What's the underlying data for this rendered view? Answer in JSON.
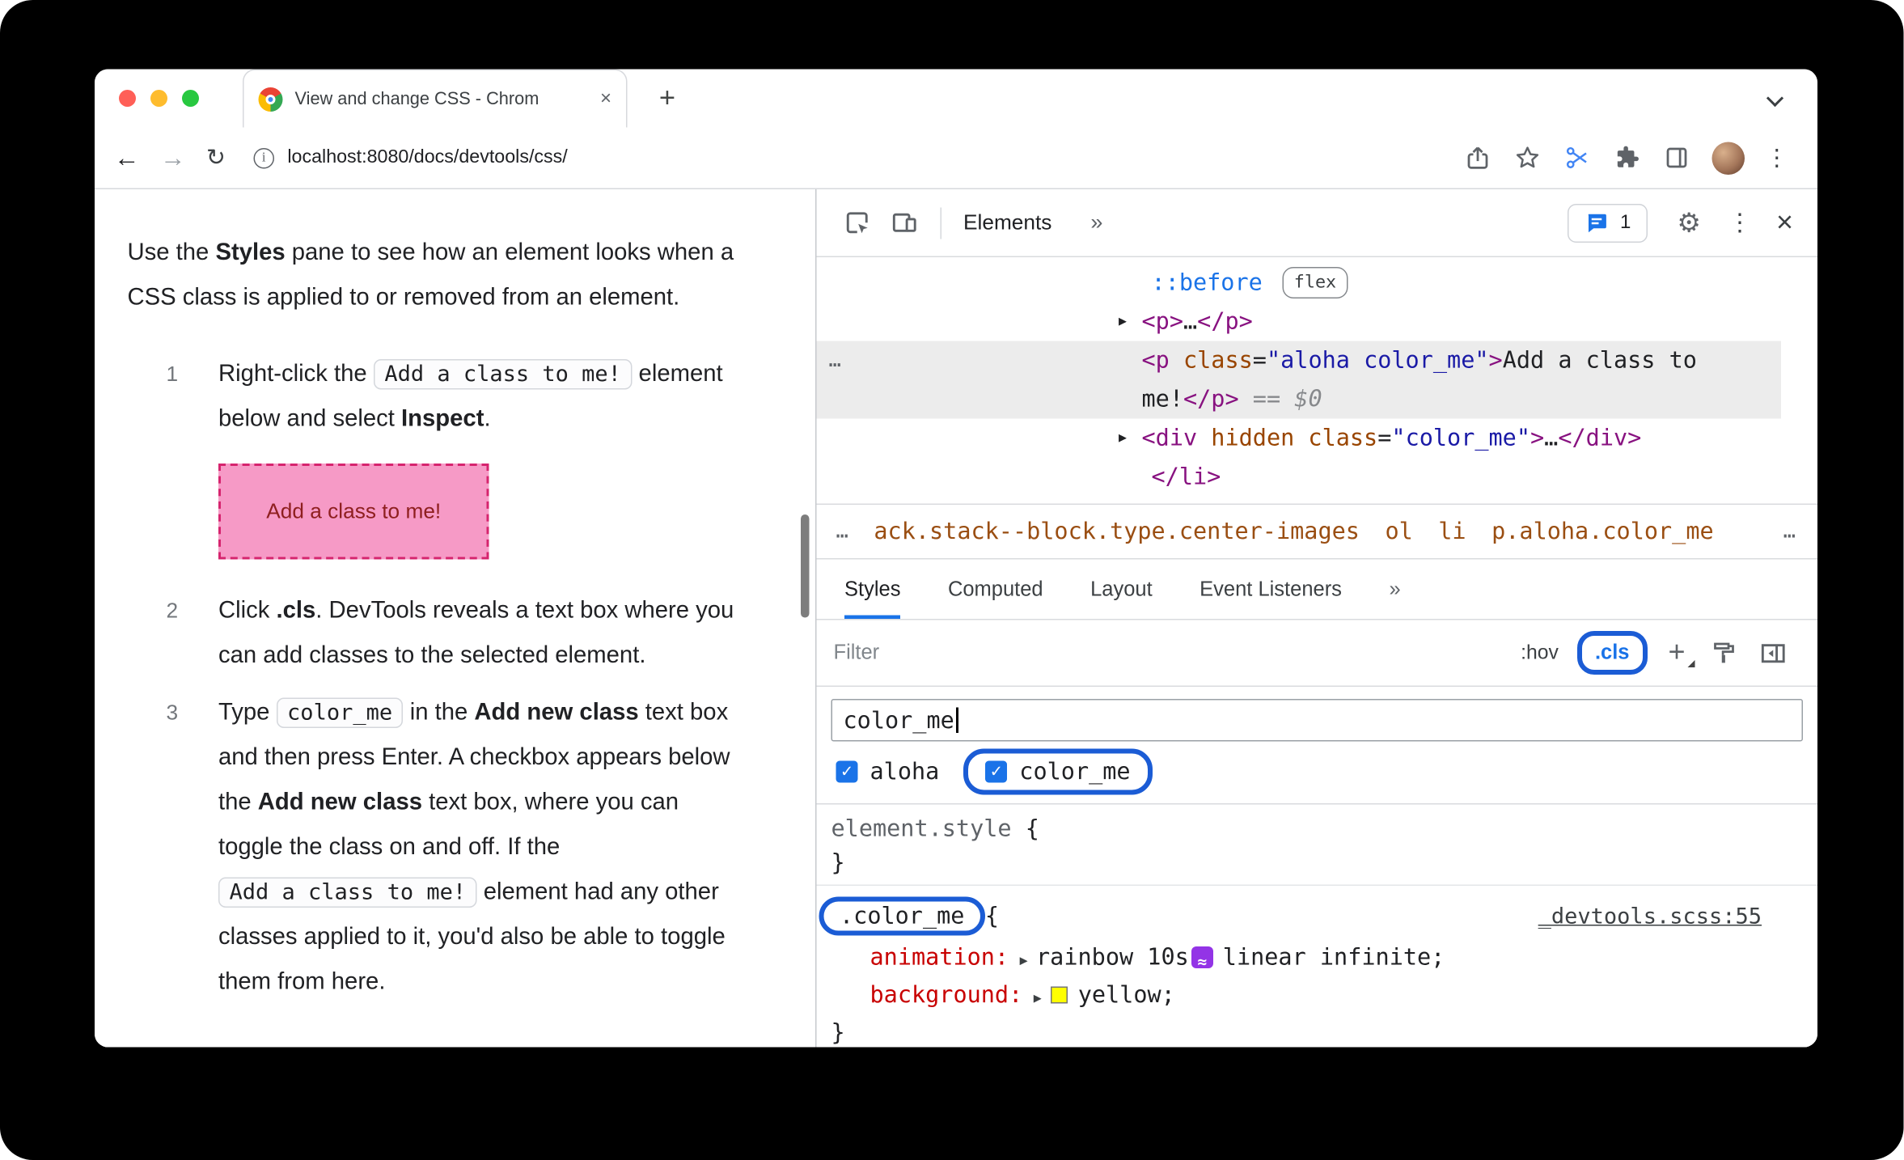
{
  "window": {
    "tab_title": "View and change CSS - Chrom",
    "url": "localhost:8080/docs/devtools/css/"
  },
  "icons": {
    "new_tab": "+",
    "tab_close": "×",
    "back": "←",
    "forward": "→",
    "reload": "↻",
    "info": "i",
    "more": "»",
    "gear": "⚙",
    "kebab": "⋮",
    "close": "×",
    "twisty": "▶",
    "dots": "…",
    "plus": "+"
  },
  "article": {
    "intro": [
      {
        "k": "plain",
        "t": "Use the "
      },
      {
        "k": "bold",
        "t": "Styles"
      },
      {
        "k": "plain",
        "t": " pane to see how an element looks when a CSS class is applied to or removed from an element."
      }
    ],
    "steps": {
      "s1": {
        "num": "1",
        "body": [
          {
            "k": "plain",
            "t": "Right-click the "
          },
          {
            "k": "code",
            "t": "Add a class to me!"
          },
          {
            "k": "plain",
            "t": " element below and select "
          },
          {
            "k": "bold",
            "t": "Inspect"
          },
          {
            "k": "plain",
            "t": "."
          }
        ]
      },
      "s2": {
        "num": "2",
        "body": [
          {
            "k": "plain",
            "t": "Click "
          },
          {
            "k": "bold",
            "t": ".cls"
          },
          {
            "k": "plain",
            "t": ". DevTools reveals a text box where you can add classes to the selected element."
          }
        ]
      },
      "s3": {
        "num": "3",
        "body": [
          {
            "k": "plain",
            "t": "Type "
          },
          {
            "k": "code",
            "t": "color_me"
          },
          {
            "k": "plain",
            "t": " in the "
          },
          {
            "k": "bold",
            "t": "Add new class"
          },
          {
            "k": "plain",
            "t": " text box and then press Enter. A checkbox appears below the "
          },
          {
            "k": "bold",
            "t": "Add new class"
          },
          {
            "k": "plain",
            "t": " text box, where you can toggle the class on and off. If the "
          },
          {
            "k": "code",
            "t": "Add a class to me!"
          },
          {
            "k": "plain",
            "t": " element had any other classes applied to it, you'd also be able to toggle them from here."
          }
        ]
      }
    },
    "demo_box_label": "Add a class to me!"
  },
  "devtools": {
    "panel_tab": "Elements",
    "messages_count": "1",
    "dom_rows": {
      "r1": [
        {
          "k": "pseudo",
          "t": "::before"
        },
        {
          "k": "badge",
          "t": "flex"
        }
      ],
      "r2": [
        {
          "k": "tag",
          "t": "<p>"
        },
        {
          "k": "txt",
          "t": "…"
        },
        {
          "k": "tag",
          "t": "</p>"
        }
      ],
      "r3a": [
        {
          "k": "tag",
          "t": "<p"
        },
        {
          "k": "attr",
          "t": " class"
        },
        {
          "k": "punc",
          "t": "="
        },
        {
          "k": "str",
          "t": "\"aloha color_me\""
        },
        {
          "k": "tag",
          "t": ">"
        },
        {
          "k": "txt",
          "t": "Add a class to"
        }
      ],
      "r3b": [
        {
          "k": "txt",
          "t": "me!"
        },
        {
          "k": "tag",
          "t": "</p>"
        },
        {
          "k": "meta",
          "t": " == "
        },
        {
          "k": "dollar",
          "t": "$0"
        }
      ],
      "r4": [
        {
          "k": "tag",
          "t": "<div"
        },
        {
          "k": "attr",
          "t": " hidden class"
        },
        {
          "k": "punc",
          "t": "="
        },
        {
          "k": "str",
          "t": "\"color_me\""
        },
        {
          "k": "tag",
          "t": ">"
        },
        {
          "k": "txt",
          "t": "…"
        },
        {
          "k": "tag",
          "t": "</div>"
        }
      ],
      "r5": [
        {
          "k": "tag",
          "t": "</li>"
        }
      ]
    },
    "breadcrumbs": {
      "lead": "…",
      "c1": "ack.stack--block.type.center-images",
      "c2": "ol",
      "c3": "li",
      "c4": "p.aloha.color_me",
      "trail": "…"
    },
    "subtabs": {
      "t1": "Styles",
      "t2": "Computed",
      "t3": "Layout",
      "t4": "Event Listeners",
      "more": "»"
    },
    "filter_row": {
      "placeholder": "Filter",
      "hov": ":hov",
      "cls": ".cls"
    },
    "class_editor": {
      "value": "color_me",
      "cb1": "aloha",
      "cb1_checked": true,
      "cb2": "color_me",
      "cb2_checked": true
    },
    "rules": {
      "r1_selector": "element.style",
      "r1_open": " {",
      "r1_close": "}",
      "r2_selector": ".color_me",
      "r2_open": " {",
      "r2_close": "}",
      "r2_link": "_devtools.scss:55",
      "p1": [
        {
          "k": "prop",
          "t": "animation:"
        },
        {
          "k": "arrow"
        },
        {
          "k": "val",
          "t": "rainbow 10s"
        },
        {
          "k": "bezier"
        },
        {
          "k": "val",
          "t": "linear infinite;"
        }
      ],
      "p2": [
        {
          "k": "prop",
          "t": "background:"
        },
        {
          "k": "arrow"
        },
        {
          "k": "swatch"
        },
        {
          "k": "val",
          "t": "yellow;"
        }
      ]
    }
  },
  "colors": {
    "callout_blue": "#1b5cd5",
    "devtools_accent": "#1a73e8",
    "tag_purple": "#881280",
    "attr_orange": "#994500",
    "value_blue": "#1a1aa6",
    "property_red": "#c80000",
    "breadcrumb_brown": "#9a4e12",
    "demo_box_bg": "#f69ac6",
    "demo_box_border": "#d6246e",
    "demo_box_text": "#8e1f1f",
    "swatch_yellow": "#ffff00",
    "selected_row_bg": "#ececec"
  }
}
